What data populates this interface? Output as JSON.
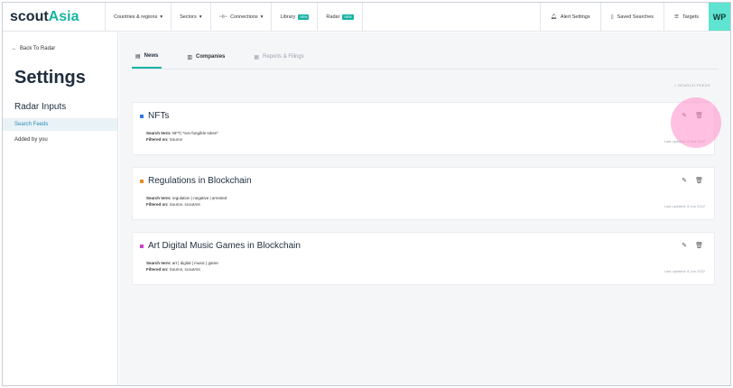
{
  "app": {
    "logo_scout": "scout",
    "logo_asia": "Asia"
  },
  "nav": [
    {
      "label": "Countries & regions",
      "icon": "chevron-down-icon"
    },
    {
      "label": "Sectors",
      "icon": "chevron-down-icon"
    },
    {
      "label": "Connections",
      "icon": "connections-icon"
    },
    {
      "label": "Library",
      "badge": "NEW"
    },
    {
      "label": "Radar",
      "badge": "NEW"
    }
  ],
  "tools": {
    "alert_settings": "Alert Settings",
    "saved_searches": "Saved Searches",
    "targets": "Targets"
  },
  "user": {
    "initials": "WP"
  },
  "sidebar": {
    "back": "Back To Radar",
    "title": "Settings",
    "section": "Radar Inputs",
    "items": [
      "Search Feeds",
      "Added by you"
    ]
  },
  "tabs": [
    "News",
    "Companies",
    "Reports & Filings"
  ],
  "search_feeds_link": "+ SEARCH FEEDS",
  "feeds": [
    {
      "title": "NFTs",
      "color": "#2b7be4",
      "term_label": "Search term:",
      "term": "NFT| \"non fungible token\"",
      "filter_label": "Filtered on:",
      "filter": "Source",
      "updated": "Last updated: 8 Jun 2022"
    },
    {
      "title": "Regulations in Blockchain",
      "color": "#f08a24",
      "term_label": "Search term:",
      "term": "regulation | negative | arrested",
      "filter_label": "Filtered on:",
      "filter": "Source, scoutAIs",
      "updated": "Last updated: 8 Jun 2022"
    },
    {
      "title": "Art Digital Music Games in Blockchain",
      "color": "#c93fd1",
      "term_label": "Search term:",
      "term": "art | digital | music | game",
      "filter_label": "Filtered on:",
      "filter": "Source, scoutAIs",
      "updated": "Last updated: 8 Jun 2022"
    }
  ],
  "colors": {
    "accent": "#17b3a3",
    "highlight": "#ff8cc8",
    "active_bg": "#e9f2f7"
  }
}
